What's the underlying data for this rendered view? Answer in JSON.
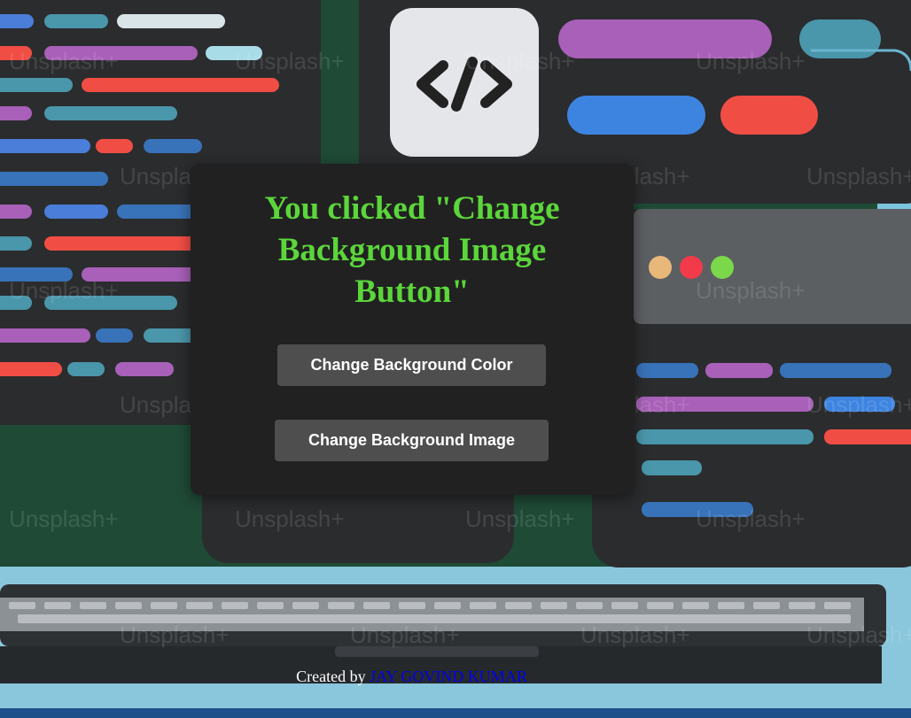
{
  "card": {
    "message": "You clicked \"Change Background Image Button\"",
    "buttons": {
      "change_color": "Change Background Color",
      "change_image": "Change Background Image"
    }
  },
  "footer": {
    "created_by_text": "Created by",
    "author_link": "JAY GOVIND KUMAR"
  },
  "background": {
    "watermark": "Unsplash+",
    "colors": {
      "message_green": "#5bd63b",
      "card_bg": "#212121",
      "button_bg": "#4e4e4e",
      "link_blue": "#0000ee"
    },
    "icon": "code-brackets-icon"
  }
}
